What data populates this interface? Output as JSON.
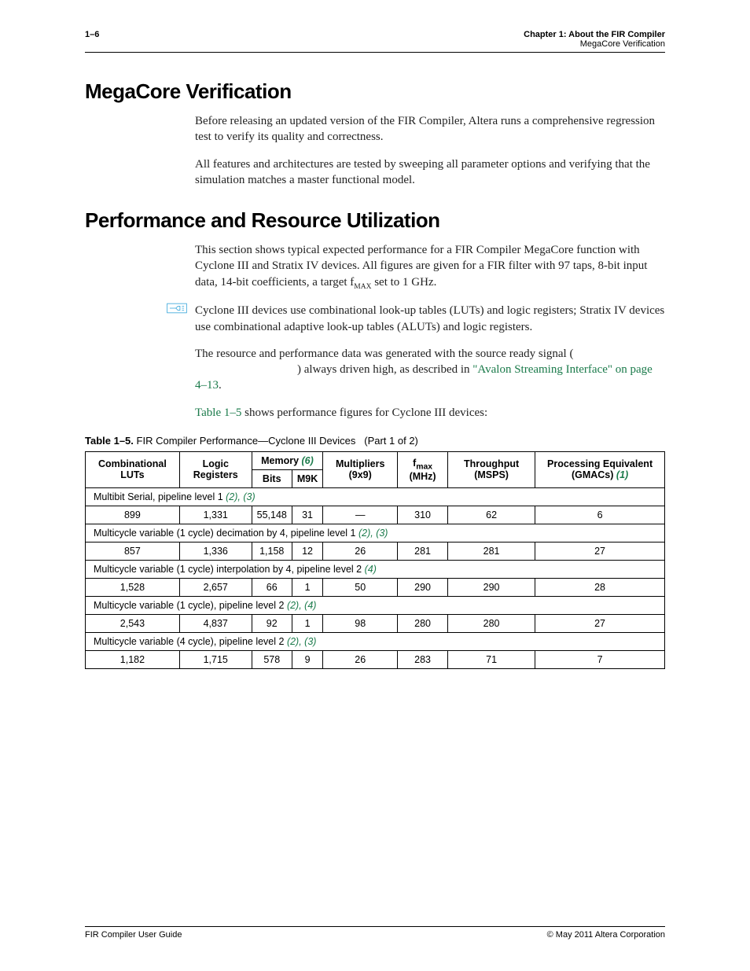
{
  "header": {
    "page_num": "1–6",
    "chapter": "Chapter 1:  About the FIR Compiler",
    "subsection": "MegaCore Verification"
  },
  "section1": {
    "title": "MegaCore Verification",
    "para1": "Before releasing an updated version of the FIR Compiler, Altera runs a comprehensive regression test to verify its quality and correctness.",
    "para2": "All features and architectures are tested by sweeping all parameter options and verifying that the simulation matches a master functional model."
  },
  "section2": {
    "title": "Performance and Resource Utilization",
    "para1_pre": "This section shows typical expected performance for a FIR Compiler MegaCore function with Cyclone III and Stratix IV devices. All figures are given for a FIR filter with 97 taps, 8-bit input data, 14-bit coefficients, a target f",
    "para1_sub": "MAX",
    "para1_post": " set to 1 GHz.",
    "note": "Cyclone III devices use combinational look-up tables (LUTs) and logic registers; Stratix IV devices use combinational adaptive look-up tables (ALUTs) and logic registers.",
    "para2_pre": "The resource and performance data was generated with the source ready signal (",
    "para2_mid": ") always driven high, as described in ",
    "para2_link": "\"Avalon Streaming Interface\" on page 4–13",
    "para2_post": ".",
    "para3_link": "Table 1–5",
    "para3_post": " shows performance figures for Cyclone III devices:"
  },
  "table": {
    "caption_label": "Table 1–5.",
    "caption_text": "FIR Compiler Performance—Cyclone III Devices",
    "caption_part": "(Part 1 of 2)",
    "headers": {
      "comb_luts": "Combinational LUTs",
      "logic_regs": "Logic Registers",
      "memory": "Memory",
      "memory_note": "(6)",
      "bits": "Bits",
      "m9k": "M9K",
      "multipliers": "Multipliers (9x9)",
      "fmax_pre": "f",
      "fmax_sub": "max",
      "fmax_post": " (MHz)",
      "throughput": "Throughput (MSPS)",
      "processing": "Processing Equivalent (GMACs)",
      "processing_note": "(1)"
    },
    "groups": [
      {
        "label": "Multibit Serial, pipeline level 1 ",
        "notes": "(2), (3)",
        "rows": [
          {
            "luts": "899",
            "regs": "1,331",
            "bits": "55,148",
            "m9k": "31",
            "mult": "—",
            "fmax": "310",
            "tput": "62",
            "gmacs": "6"
          }
        ]
      },
      {
        "label": "Multicycle variable (1 cycle) decimation by 4, pipeline level 1 ",
        "notes": "(2), (3)",
        "rows": [
          {
            "luts": "857",
            "regs": "1,336",
            "bits": "1,158",
            "m9k": "12",
            "mult": "26",
            "fmax": "281",
            "tput": "281",
            "gmacs": "27"
          }
        ]
      },
      {
        "label": "Multicycle variable (1 cycle) interpolation by 4, pipeline level 2 ",
        "notes": "(4)",
        "rows": [
          {
            "luts": "1,528",
            "regs": "2,657",
            "bits": "66",
            "m9k": "1",
            "mult": "50",
            "fmax": "290",
            "tput": "290",
            "gmacs": "28"
          }
        ]
      },
      {
        "label": "Multicycle variable (1 cycle), pipeline level 2 ",
        "notes": "(2), (4)",
        "rows": [
          {
            "luts": "2,543",
            "regs": "4,837",
            "bits": "92",
            "m9k": "1",
            "mult": "98",
            "fmax": "280",
            "tput": "280",
            "gmacs": "27"
          }
        ]
      },
      {
        "label": "Multicycle variable (4 cycle), pipeline level 2 ",
        "notes": "(2), (3)",
        "rows": [
          {
            "luts": "1,182",
            "regs": "1,715",
            "bits": "578",
            "m9k": "9",
            "mult": "26",
            "fmax": "283",
            "tput": "71",
            "gmacs": "7"
          }
        ]
      }
    ]
  },
  "footer": {
    "left": "FIR Compiler User Guide",
    "right": "© May 2011   Altera Corporation"
  }
}
